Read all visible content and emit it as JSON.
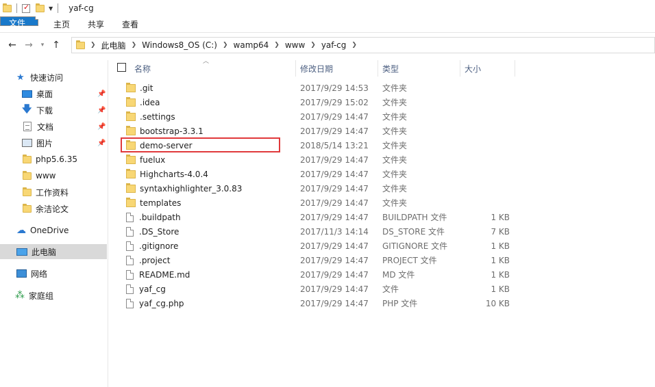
{
  "window": {
    "title": "yaf-cg"
  },
  "ribbon": {
    "tabs": [
      "文件",
      "主页",
      "共享",
      "查看"
    ]
  },
  "address": {
    "crumbs": [
      "此电脑",
      "Windows8_OS (C:)",
      "wamp64",
      "www",
      "yaf-cg"
    ]
  },
  "sidebar": {
    "quick_access": "快速访问",
    "items": [
      {
        "label": "桌面",
        "icon": "desktop-icon",
        "pinned": true
      },
      {
        "label": "下载",
        "icon": "download-icon",
        "pinned": true
      },
      {
        "label": "文档",
        "icon": "document-icon",
        "pinned": true
      },
      {
        "label": "图片",
        "icon": "pictures-icon",
        "pinned": true
      },
      {
        "label": "php5.6.35",
        "icon": "folder-icon",
        "pinned": false
      },
      {
        "label": "www",
        "icon": "folder-icon",
        "pinned": false
      },
      {
        "label": "工作资料",
        "icon": "folder-icon",
        "pinned": false
      },
      {
        "label": "余洁论文",
        "icon": "folder-icon",
        "pinned": false
      }
    ],
    "onedrive": "OneDrive",
    "this_pc": "此电脑",
    "network": "网络",
    "homegroup": "家庭组"
  },
  "columns": {
    "name": "名称",
    "date": "修改日期",
    "type": "类型",
    "size": "大小"
  },
  "files": [
    {
      "name": ".git",
      "date": "2017/9/29 14:53",
      "type": "文件夹",
      "size": "",
      "kind": "folder"
    },
    {
      "name": ".idea",
      "date": "2017/9/29 15:02",
      "type": "文件夹",
      "size": "",
      "kind": "folder"
    },
    {
      "name": ".settings",
      "date": "2017/9/29 14:47",
      "type": "文件夹",
      "size": "",
      "kind": "folder"
    },
    {
      "name": "bootstrap-3.3.1",
      "date": "2017/9/29 14:47",
      "type": "文件夹",
      "size": "",
      "kind": "folder"
    },
    {
      "name": "demo-server",
      "date": "2018/5/14 13:21",
      "type": "文件夹",
      "size": "",
      "kind": "folder"
    },
    {
      "name": "fuelux",
      "date": "2017/9/29 14:47",
      "type": "文件夹",
      "size": "",
      "kind": "folder"
    },
    {
      "name": "Highcharts-4.0.4",
      "date": "2017/9/29 14:47",
      "type": "文件夹",
      "size": "",
      "kind": "folder"
    },
    {
      "name": "syntaxhighlighter_3.0.83",
      "date": "2017/9/29 14:47",
      "type": "文件夹",
      "size": "",
      "kind": "folder"
    },
    {
      "name": "templates",
      "date": "2017/9/29 14:47",
      "type": "文件夹",
      "size": "",
      "kind": "folder"
    },
    {
      "name": ".buildpath",
      "date": "2017/9/29 14:47",
      "type": "BUILDPATH 文件",
      "size": "1 KB",
      "kind": "file"
    },
    {
      "name": ".DS_Store",
      "date": "2017/11/3 14:14",
      "type": "DS_STORE 文件",
      "size": "7 KB",
      "kind": "file"
    },
    {
      "name": ".gitignore",
      "date": "2017/9/29 14:47",
      "type": "GITIGNORE 文件",
      "size": "1 KB",
      "kind": "file"
    },
    {
      "name": ".project",
      "date": "2017/9/29 14:47",
      "type": "PROJECT 文件",
      "size": "1 KB",
      "kind": "file"
    },
    {
      "name": "README.md",
      "date": "2017/9/29 14:47",
      "type": "MD 文件",
      "size": "1 KB",
      "kind": "file"
    },
    {
      "name": "yaf_cg",
      "date": "2017/9/29 14:47",
      "type": "文件",
      "size": "1 KB",
      "kind": "file"
    },
    {
      "name": "yaf_cg.php",
      "date": "2017/9/29 14:47",
      "type": "PHP 文件",
      "size": "10 KB",
      "kind": "file"
    }
  ],
  "colors": {
    "file_tab": "#1979ca",
    "highlight_border": "#e0383a",
    "folder": "#f8d775"
  }
}
